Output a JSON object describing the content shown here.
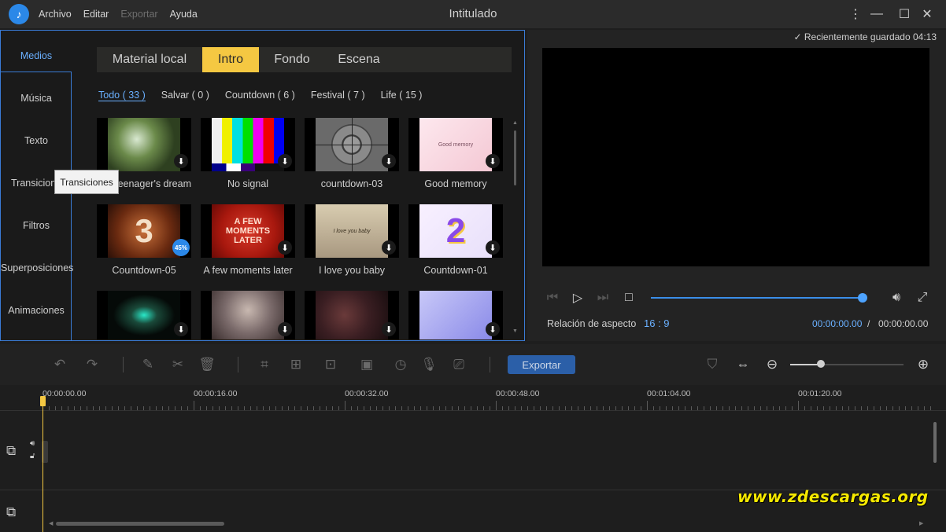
{
  "window": {
    "title": "Intitulado",
    "menu": [
      "Archivo",
      "Editar",
      "Exportar",
      "Ayuda"
    ],
    "menu_disabled": [
      false,
      false,
      true,
      false
    ]
  },
  "sidebar": {
    "items": [
      {
        "label": "Medios",
        "active": true
      },
      {
        "label": "Música"
      },
      {
        "label": "Texto"
      },
      {
        "label": "Transiciones"
      },
      {
        "label": "Filtros"
      },
      {
        "label": "Superposiciones"
      },
      {
        "label": "Animaciones"
      }
    ],
    "tooltip": "Transiciones"
  },
  "media": {
    "tabs": [
      "Material local",
      "Intro",
      "Fondo",
      "Escena"
    ],
    "active_tab": "Intro",
    "filters": [
      "Todo ( 33 )",
      "Salvar ( 0 )",
      "Countdown ( 6 )",
      "Festival ( 7 )",
      "Life ( 15 )"
    ],
    "active_filter": "Todo ( 33 )",
    "thumbnails": [
      {
        "label": "Teenager's dream",
        "badge": "download-icon"
      },
      {
        "label": "No signal",
        "badge": "download-icon"
      },
      {
        "label": "countdown-03",
        "badge": "download-icon"
      },
      {
        "label": "Good memory",
        "badge": "download-icon"
      },
      {
        "label": "Countdown-05",
        "badge": "progress",
        "progress": "45%"
      },
      {
        "label": "A few moments later",
        "badge": "download-icon"
      },
      {
        "label": "I love you baby",
        "badge": "download-icon"
      },
      {
        "label": "Countdown-01",
        "badge": "download-icon"
      },
      {
        "label": "",
        "badge": "download-icon"
      },
      {
        "label": "",
        "badge": "download-icon"
      },
      {
        "label": "",
        "badge": "download-icon"
      },
      {
        "label": "",
        "badge": "download-icon"
      }
    ],
    "thumb_text": {
      "good_memory": "Good memory",
      "few_moments": "A FEW MOMENTS LATER",
      "love_baby": "I love you baby",
      "countdown_3": "3",
      "countdown_2": "2"
    }
  },
  "preview": {
    "saved_text": "Recientemente guardado 04:13",
    "aspect_label": "Relación de aspecto",
    "aspect_value": "16 : 9",
    "time_current": "00:00:00.00",
    "time_separator": "/",
    "time_total": "00:00:00.00",
    "seek_fraction": 1.0
  },
  "toolbar": {
    "export_label": "Exportar",
    "zoom_fraction": 0.27
  },
  "timeline": {
    "ruler_labels": [
      "00:00:00.00",
      "00:00:16.00",
      "00:00:32.00",
      "00:00:48.00",
      "00:01:04.00",
      "00:01:20.00"
    ]
  },
  "watermark": "www.zdescargas.org",
  "colors": {
    "accent": "#3a7bd5",
    "tab_active": "#f5c842",
    "playhead": "#f5c842",
    "export_button": "#2b5fa8"
  }
}
